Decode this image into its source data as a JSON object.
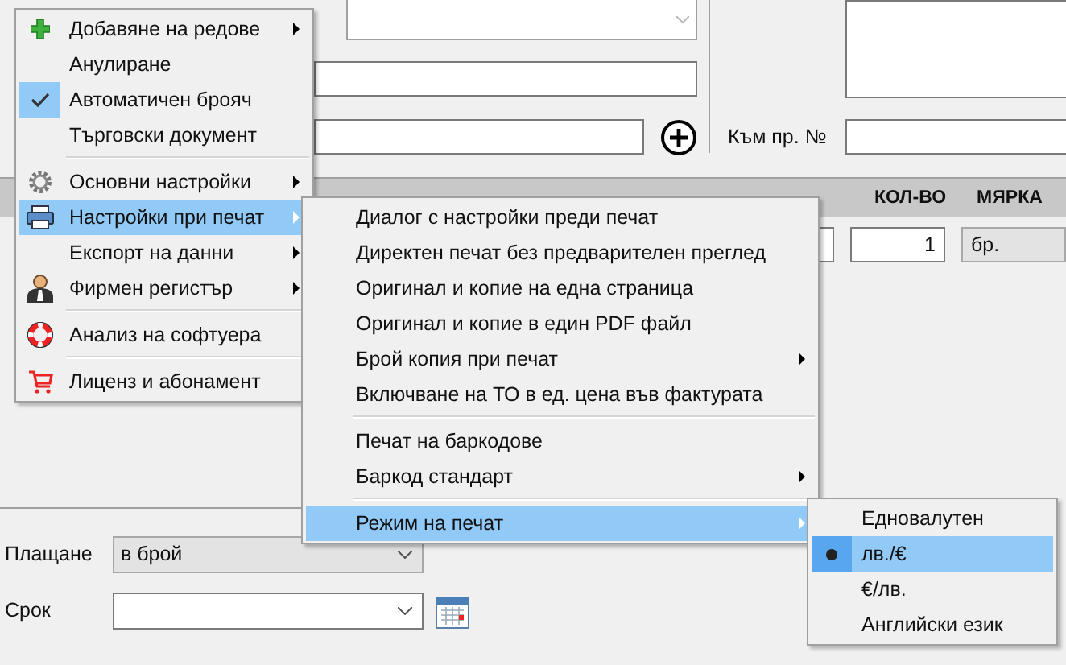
{
  "form": {
    "reference_label": "Към пр. №"
  },
  "table": {
    "columns": [
      "КОЛ-ВО",
      "МЯРКА"
    ],
    "row": {
      "quantity": "1",
      "unit": "бр."
    }
  },
  "payment": {
    "label": "Плащане",
    "value": "в брой"
  },
  "due": {
    "label": "Срок"
  },
  "menus": [
    {
      "items": [
        {
          "kind": "item",
          "label": "Добавяне на редове",
          "submenu": true,
          "checked": false,
          "selected": false
        },
        {
          "kind": "item",
          "label": "Анулиране",
          "submenu": false,
          "checked": false,
          "selected": false
        },
        {
          "kind": "item",
          "label": "Автоматичен брояч",
          "submenu": false,
          "checked": true,
          "selected": false
        },
        {
          "kind": "item",
          "label": "Търговски документ",
          "submenu": false,
          "checked": false,
          "selected": false
        },
        {
          "kind": "separator"
        },
        {
          "kind": "item",
          "label": "Основни настройки",
          "submenu": true,
          "checked": false,
          "selected": false
        },
        {
          "kind": "item",
          "label": "Настройки при печат",
          "submenu": true,
          "checked": false,
          "selected": true
        },
        {
          "kind": "item",
          "label": "Експорт на данни",
          "submenu": true,
          "checked": false,
          "selected": false
        },
        {
          "kind": "item",
          "label": "Фирмен регистър",
          "submenu": true,
          "checked": false,
          "selected": false
        },
        {
          "kind": "separator"
        },
        {
          "kind": "item",
          "label": "Анализ на софтуера",
          "submenu": false,
          "checked": false,
          "selected": false
        },
        {
          "kind": "separator"
        },
        {
          "kind": "item",
          "label": "Лиценз и абонамент",
          "submenu": false,
          "checked": false,
          "selected": false
        }
      ]
    },
    {
      "items": [
        {
          "kind": "item",
          "label": "Диалог с настройки преди печат",
          "submenu": false,
          "selected": false
        },
        {
          "kind": "item",
          "label": "Директен печат без предварителен преглед",
          "submenu": false,
          "selected": false
        },
        {
          "kind": "item",
          "label": "Оригинал и копие на една страница",
          "submenu": false,
          "selected": false
        },
        {
          "kind": "item",
          "label": "Оригинал и копие в един PDF файл",
          "submenu": false,
          "selected": false
        },
        {
          "kind": "item",
          "label": "Брой копия при печат",
          "submenu": true,
          "selected": false
        },
        {
          "kind": "item",
          "label": "Включване на ТО в ед. цена във фактурата",
          "submenu": false,
          "selected": false
        },
        {
          "kind": "separator"
        },
        {
          "kind": "item",
          "label": "Печат на баркодове",
          "submenu": false,
          "selected": false
        },
        {
          "kind": "item",
          "label": "Баркод стандарт",
          "submenu": true,
          "selected": false
        },
        {
          "kind": "separator"
        },
        {
          "kind": "item",
          "label": "Режим на печат",
          "submenu": true,
          "selected": true
        }
      ]
    },
    {
      "items": [
        {
          "kind": "radio",
          "label": "Едновалутен",
          "checked": false,
          "selected": false
        },
        {
          "kind": "radio",
          "label": "лв./€",
          "checked": true,
          "selected": true
        },
        {
          "kind": "radio",
          "label": "€/лв.",
          "checked": false,
          "selected": false
        },
        {
          "kind": "radio",
          "label": "Английски език",
          "checked": false,
          "selected": false
        }
      ]
    }
  ]
}
